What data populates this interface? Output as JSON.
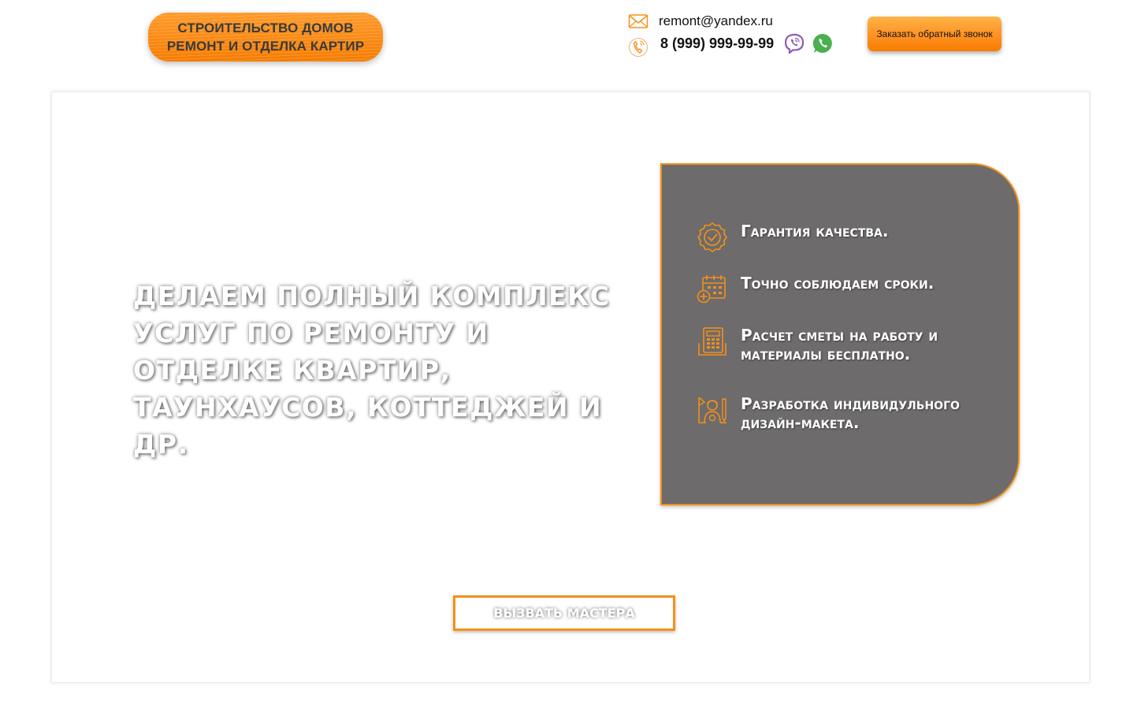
{
  "header": {
    "logo_line1": "СТРОИТЕЛЬСТВО ДОМОВ",
    "logo_line2": "РЕМОНТ И ОТДЕЛКА КАРТИР",
    "email": "remont@yandex.ru",
    "phone": "8 (999) 999-99-99",
    "callback_label": "Заказать обратный звонок"
  },
  "hero": {
    "title": "Делаем полный комплекс услуг по ремонту и отделке квартир, таунхаусов, коттеджей и др.",
    "features": [
      {
        "icon": "quality-badge-icon",
        "text": "Гарантия качества."
      },
      {
        "icon": "calendar-icon",
        "text": "Точно соблюдаем сроки."
      },
      {
        "icon": "calculator-icon",
        "text": "Расчет сметы на работу и материалы бесплатно."
      },
      {
        "icon": "designer-icon",
        "text": "Разработка индивидульного дизайн-макета."
      }
    ],
    "cta_label": "Вызвать мастера"
  },
  "colors": {
    "accent": "#f5901a",
    "card_bg": "#6d6b6b",
    "viber": "#8f5db7",
    "whatsapp": "#4caf50"
  }
}
